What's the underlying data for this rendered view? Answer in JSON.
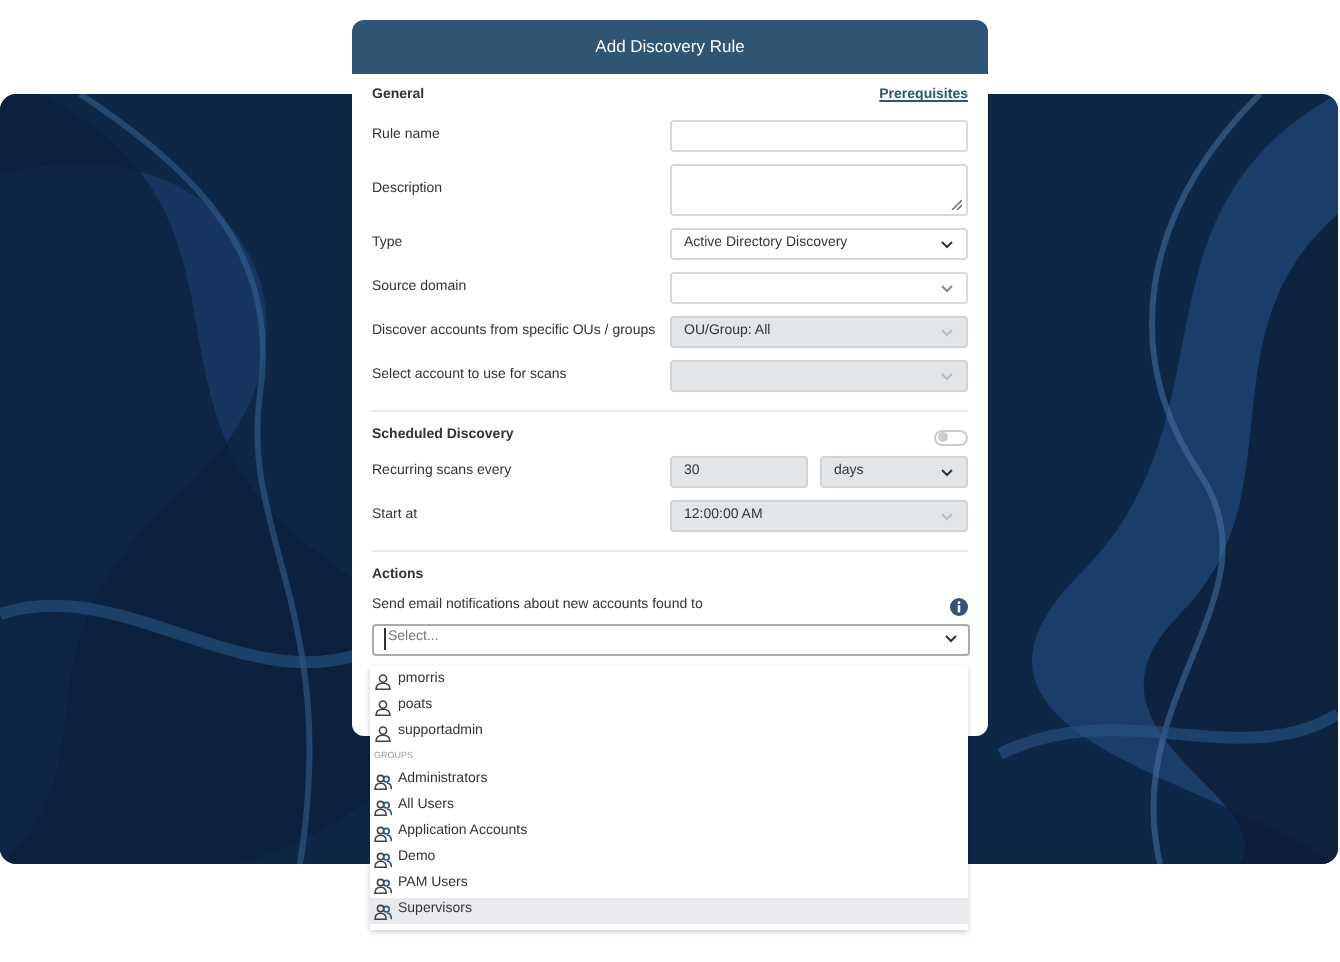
{
  "modal": {
    "title": "Add Discovery Rule",
    "sections": [
      {
        "heading": "General",
        "link": "Prerequisites",
        "fields": [
          {
            "label": "Rule name",
            "kind": "text",
            "disabled": false
          },
          {
            "label": "Description",
            "kind": "textarea",
            "disabled": false
          },
          {
            "label": "Type",
            "kind": "select",
            "value": "Active Directory Discovery",
            "disabled": false
          },
          {
            "label": "Source domain",
            "kind": "select",
            "disabled": false
          },
          {
            "label": "Discover accounts from specific OUs / groups",
            "kind": "select",
            "value": "OU/Group: All",
            "disabled": true
          },
          {
            "label": "Select account to use for scans",
            "kind": "select",
            "disabled": true
          }
        ]
      },
      {
        "heading": "Scheduled Discovery",
        "toggle": {
          "on": false
        },
        "fields": [
          {
            "label": "Recurring scans every",
            "kind": "pair",
            "value": "30",
            "unit": "days",
            "disabled": true
          },
          {
            "label": "Start at",
            "kind": "select",
            "value": "12:00:00 AM",
            "disabled": true
          }
        ]
      },
      {
        "heading": "Actions",
        "fields": [
          {
            "label": "Send email notifications about new accounts found to",
            "kind": "wide-select",
            "info": true,
            "placeholder": "Select...",
            "disabled": false
          }
        ]
      }
    ]
  },
  "dropdown": {
    "options": [
      {
        "kind": "user",
        "label": "pmorris",
        "selected": false
      },
      {
        "kind": "user",
        "label": "poats",
        "selected": false
      },
      {
        "kind": "user",
        "label": "supportadmin",
        "selected": false
      },
      {
        "kind": "header",
        "label": "GROUPS"
      },
      {
        "kind": "group",
        "label": "Administrators",
        "selected": false
      },
      {
        "kind": "group",
        "label": "All Users",
        "selected": false
      },
      {
        "kind": "group",
        "label": "Application Accounts",
        "selected": false
      },
      {
        "kind": "group",
        "label": "Demo",
        "selected": false
      },
      {
        "kind": "group",
        "label": "PAM Users",
        "selected": false
      },
      {
        "kind": "group",
        "label": "Supervisors",
        "selected": true
      }
    ]
  }
}
